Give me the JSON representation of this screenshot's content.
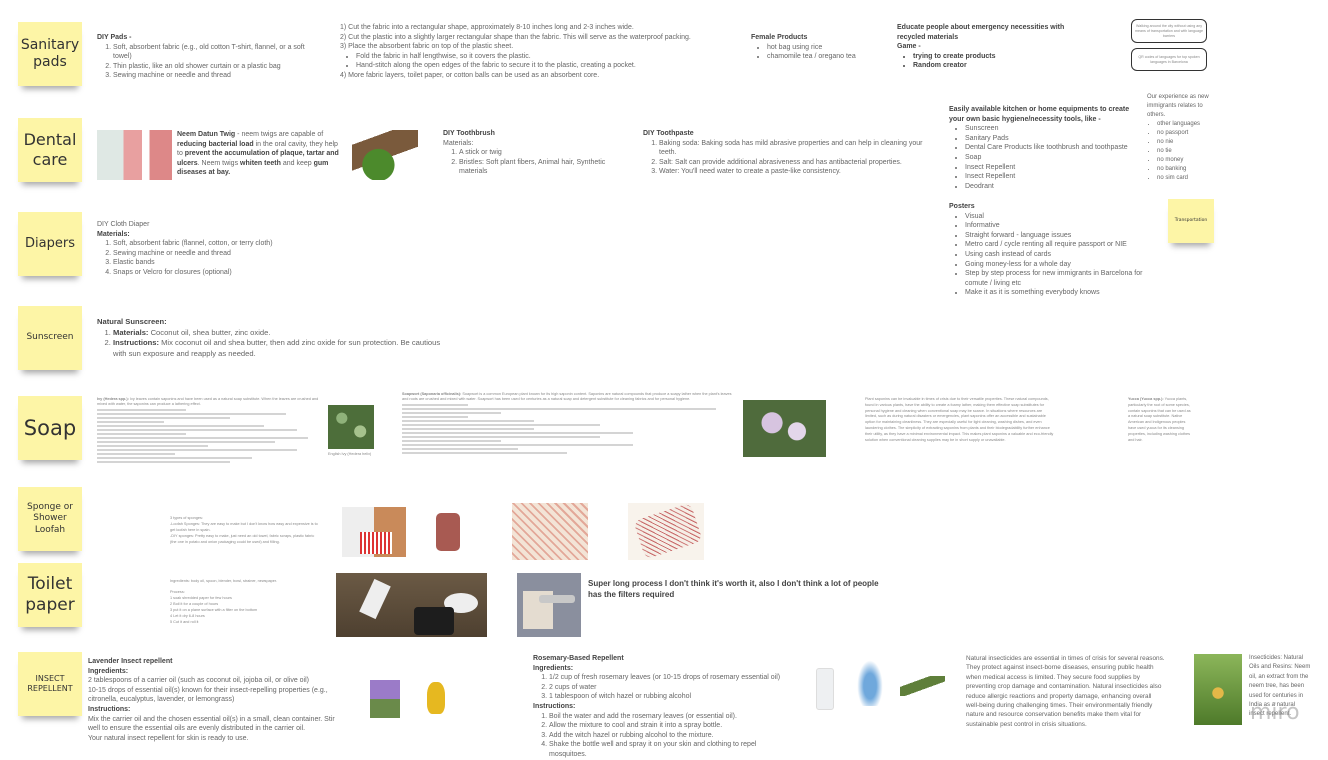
{
  "stickies": {
    "sanitary": "Sanitary pads",
    "dental": "Dental care",
    "diapers": "Diapers",
    "sunscreen": "Sunscreen",
    "soap": "Soap",
    "sponge": "Sponge or Shower Loofah",
    "toilet": "Toilet paper",
    "insect": "INSECT REPELLENT",
    "transportation": "Transportation"
  },
  "sanitary": {
    "title": "DIY Pads -",
    "materials": [
      "Soft, absorbent fabric (e.g., old cotton T-shirt, flannel, or a soft towel)",
      "Thin plastic, like an old shower curtain or a plastic bag",
      "Sewing machine or needle and thread"
    ],
    "steps": [
      "1) Cut the fabric into a rectangular shape, approximately 8-10 inches long and 2-3 inches wide.",
      "2) Cut the plastic into a slightly larger rectangular shape than the fabric. This will serve as the waterproof packing.",
      "3) Place the absorbent fabric on top of the plastic sheet.",
      "Fold the fabric in half lengthwise, so it covers the plastic.",
      "Hand-stitch along the open edges of the fabric to secure it to the plastic, creating a pocket.",
      "4) More fabric layers, toilet paper, or cotton balls can be used as an absorbent core."
    ],
    "female_title": "Female Products",
    "female_items": [
      "hot bag using rice",
      "chamomile tea / oregano tea"
    ]
  },
  "educate": {
    "title": "Educate people about emergency necessities with recycled materials",
    "game": "Game -",
    "items": [
      "trying to create products",
      "Random creator"
    ]
  },
  "boxes": [
    "Walking around the city without using any means of transportation and with language barriers",
    "QR codes of languages for top spoken languages in Barcelona"
  ],
  "dental": {
    "neem_title": "Neem Datun Twig",
    "neem_1": " - neem twigs are capable of ",
    "neem_b1": "reducing bacterial load",
    "neem_2": " in the oral cavity, they help to ",
    "neem_b2": "prevent the accumulation of plaque, tartar and ulcers",
    "neem_3": ". Neem twigs ",
    "neem_b3": "whiten teeth",
    "neem_4": " and keep ",
    "neem_b4": "gum diseases at bay.",
    "brush_title": "DIY Toothbrush",
    "brush_materials": "Materials:",
    "brush_items": [
      "A stick or twig",
      "Bristles: Soft plant fibers, Animal hair, Synthetic materials"
    ],
    "paste_title": "DIY Toothpaste",
    "paste_items": [
      "Baking soda: Baking soda has mild abrasive properties and can help in cleaning your teeth.",
      "Salt: Salt can provide additional abrasiveness and has antibacterial properties.",
      "Water: You'll need water to create a paste-like consistency."
    ]
  },
  "equipments": {
    "title": "Easily available kitchen or home equipments to create your own basic hygiene/necessity tools, like -",
    "items": [
      "Sunscreen",
      "Sanitary Pads",
      "Dental Care Products like toothbrush and toothpaste",
      "Soap",
      "Insect Repellent",
      "Deodrant"
    ]
  },
  "experience": {
    "title": "Our experience as new immigrants relates to others.",
    "items": [
      "other languages",
      "no passport",
      "no nie",
      "no tie",
      "no money",
      "no banking",
      "no sim card"
    ]
  },
  "posters": {
    "title": "Posters",
    "items": [
      "Visual",
      "Informative",
      "Straight forward - language issues",
      "Metro card / cycle renting all require passport or NIE",
      "Using cash instead of cards",
      "Going money-less for a whole day",
      "Step by step process for new immigrants in Barcelona for comute / living etc",
      "Make it as it is something everybody knows"
    ]
  },
  "diapers": {
    "title": "DIY Cloth Diaper",
    "materials": "Materials:",
    "items": [
      "Soft, absorbent fabric (flannel, cotton, or terry cloth)",
      "Sewing machine or needle and thread",
      "Elastic bands",
      "Snaps or Velcro for closures (optional)"
    ]
  },
  "sunscreen": {
    "title": "Natural Sunscreen:",
    "m_label": "Materials:",
    "m_text": " Coconut oil, shea butter, zinc oxide.",
    "i_label": "Instructions:",
    "i_text": " Mix coconut oil and shea butter, then add zinc oxide for sun protection. Be cautious with sun exposure and reapply as needed."
  },
  "soap": {
    "ivy_title": "Ivy (Hedera spp.):",
    "ivy_text": " Ivy leaves contain saponins and have been used as a natural soap substitute. When the leaves are crushed and mixed with water, the saponins can produce a lathering effect.",
    "ivy_caption": "English Ivy (Hedera helix)",
    "soapwort_title": "Soapwort (Saponaria officinalis):",
    "soapwort_text": " Soapwort is a common European plant known for its high saponin content. Saponins are natural compounds that produce a soapy lather when the plant's leaves and roots are crushed and mixed with water. Soapwort has been used for centuries as a natural soap and detergent substitute for cleaning fabrics and for personal hygiene.",
    "saponins_text": "Plant saponins can be invaluable in times of crisis due to their versatile properties. These natural compounds, found in various plants, have the ability to create a foamy lather, making them effective soap substitutes for personal hygiene and cleaning when conventional soap may be scarce. In situations where resources are limited, such as during natural disasters or emergencies, plant saponins offer an accessible and sustainable option for maintaining cleanliness. They are especially useful for light cleaning, washing dishes, and even laundering clothes. The simplicity of extracting saponins from plants and their biodegradability further enhance their utility, as they have a minimal environmental impact. This makes plant saponins a valuable and eco-friendly solution when conventional cleaning supplies may be in short supply or unavailable.",
    "yucca_title": "Yucca (Yucca spp.):",
    "yucca_text": " Yucca plants, particularly the root of some species, contain saponins that can be used as a natural soap substitute. Native American and Indigenous peoples have used yucca for its cleansing properties, including washing clothes and hair."
  },
  "sponge": {
    "lines": [
      "3 types of sponges:",
      "-Loofah Sponges: They are easy to make but I don't know how easy and expensive is to get loofah here in spain.",
      "-DIY sponges: Pretty easy to make, just need an old towel, fabric scraps, plastic fabric (the one in potato and onion packaging could be used) and filling."
    ]
  },
  "toilet": {
    "ingredients": "Ingredients: body oil, spoon, blender, bowl, strainer, newspaper.",
    "process": "Process:",
    "steps": [
      "1 soak shredded paper for few hours",
      "2 Boil it for a couple of hours",
      "3 put it on a plane surface with a filter on the bottom",
      "4 Let it dry 6-8 hours",
      "5 Cut it and roll it"
    ],
    "note": "Super long process I don't think it's worth it, also I don't think a lot of people has the filters required"
  },
  "insect": {
    "lav_title": "Lavender Insect repellent",
    "ingredients": "Ingredients:",
    "lav_ing": [
      "2 tablespoons of a carrier oil (such as coconut oil, jojoba oil, or olive oil)",
      "10-15 drops of essential oil(s) known for their insect-repelling properties (e.g., citronella, eucalyptus, lavender, or lemongrass)"
    ],
    "instructions": "Instructions:",
    "lav_ins": [
      "Mix the carrier oil and the chosen essential oil(s) in a small, clean container. Stir well to ensure the essential oils are evenly distributed in the carrier oil.",
      "Your natural insect repellent for skin is ready to use."
    ],
    "ros_title": "Rosemary-Based Repellent",
    "ros_ing": [
      "1/2 cup of fresh rosemary leaves (or 10-15 drops of rosemary essential oil)",
      "2 cups of water",
      "1 tablespoon of witch hazel or rubbing alcohol"
    ],
    "ros_ins": [
      "Boil the water and add the rosemary leaves (or essential oil).",
      "Allow the mixture to cool and strain it into a spray bottle.",
      "Add the witch hazel or rubbing alcohol to the mixture.",
      "Shake the bottle well and spray it on your skin and clothing to repel mosquitoes."
    ],
    "natural_text": "Natural insecticides are essential in times of crisis for several reasons. They protect against insect-borne diseases, ensuring public health when medical access is limited. They secure food supplies by preventing crop damage and contamination. Natural insecticides also reduce allergic reactions and property damage, enhancing overall well-being during challenging times. Their environmentally friendly nature and resource conservation benefits make them vital for sustainable pest control in crisis situations.",
    "neem_text": "Insecticides: Natural Oils and Resins: Neem oil, an extract from the neem tree, has been used for centuries in India as a natural insect repellent."
  },
  "watermark": "miro",
  "colors": {
    "sticky": "#fdf5a6",
    "text": "#666666"
  }
}
